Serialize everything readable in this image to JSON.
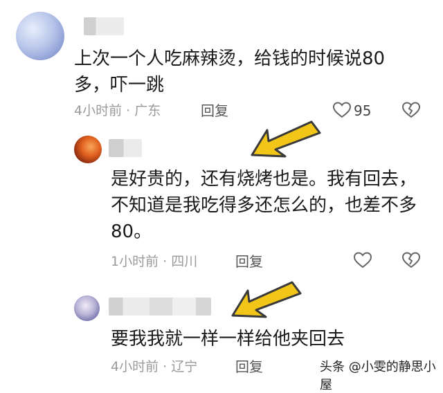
{
  "comments": [
    {
      "text": "上次一个人吃麻辣烫，给钱的时候说80\n多，吓一跳",
      "time": "4小时前 · 广东",
      "reply_label": "回复",
      "like_count": "95"
    },
    {
      "text": "是好贵的，还有烧烤也是。我有回去，\n不知道是我吃得多还怎么的，也差不多\n80。",
      "time": "1小时前 · 四川",
      "reply_label": "回复",
      "like_count": ""
    },
    {
      "text": "要我我就一样一样给他夹回去",
      "time": "4小时前 · 辽宁",
      "reply_label": "回复",
      "like_count": ""
    }
  ],
  "watermark": "头条 @小雯的静思小屋",
  "colors": {
    "text": "#1a1a1a",
    "meta": "#9a9a9a",
    "arrow_fill": "#f2c618",
    "arrow_stroke": "#3a3a3a"
  },
  "icons": [
    "heart-icon",
    "broken-heart-icon",
    "arrow-pointer-icon"
  ]
}
